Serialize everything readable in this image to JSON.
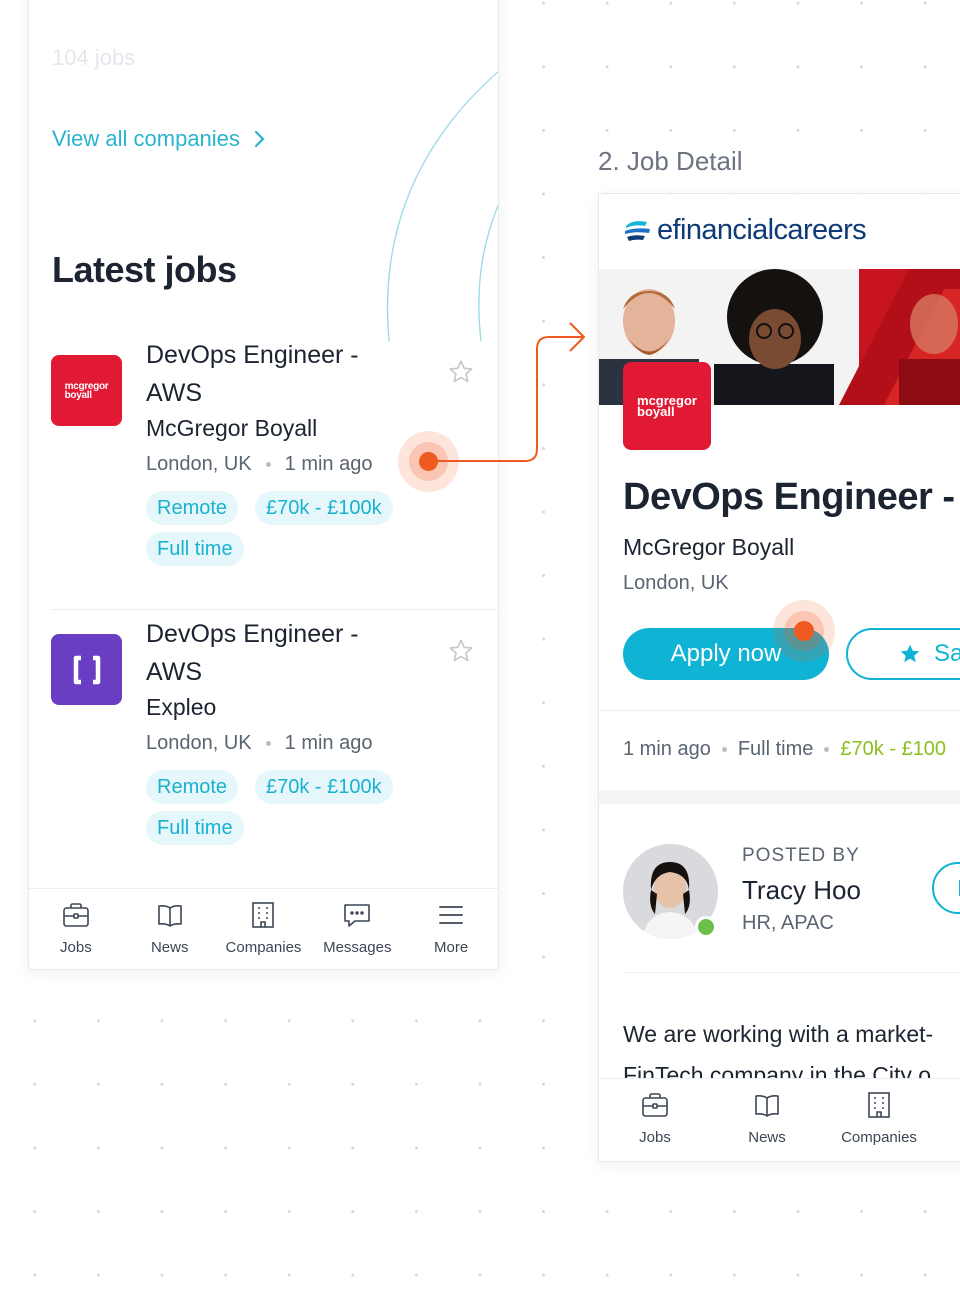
{
  "left_screen": {
    "jobs_count": "104 jobs",
    "view_all_label": "View all companies",
    "latest_title": "Latest jobs",
    "jobs": [
      {
        "logo_text": [
          "mcgregor",
          "boyall"
        ],
        "title_line1": "DevOps Engineer -",
        "title_line2": "AWS",
        "company": "McGregor Boyall",
        "location": "London, UK",
        "posted": "1 min ago",
        "tags": [
          "Remote",
          "£70k - £100k",
          "Full time"
        ]
      },
      {
        "logo_icon": "brackets-logo-icon",
        "title_line1": "DevOps Engineer -",
        "title_line2": "AWS",
        "company": "Expleo",
        "location": "London, UK",
        "posted": "1 min ago",
        "tags": [
          "Remote",
          "£70k - £100k",
          "Full time"
        ]
      }
    ],
    "nav": [
      "Jobs",
      "News",
      "Companies",
      "Messages",
      "More"
    ]
  },
  "right_screen": {
    "section_label": "2. Job Detail",
    "brand": "efinancialcareers",
    "logo_text": [
      "mcgregor",
      "boyall"
    ],
    "title": "DevOps Engineer - A",
    "company": "McGregor Boyall",
    "location": "London, UK",
    "apply_label": "Apply now",
    "save_label": "Sa",
    "meta": {
      "posted": "1 min ago",
      "type": "Full time",
      "salary": "£70k - £100"
    },
    "posted_by_label": "POSTED BY",
    "poster_name": "Tracy Hoo",
    "poster_role": "HR, APAC",
    "description_line1": "We are working with a market-",
    "description_line2": "FinTech company in the City o",
    "nav": [
      "Jobs",
      "News",
      "Companies"
    ]
  },
  "colors": {
    "accent": "#0fb3d3",
    "connector": "#ee5a1f",
    "logo_red": "#e21935",
    "logo_purple": "#6a3ec2",
    "salary_green": "#8bbf1f",
    "online": "#6cc04a"
  }
}
